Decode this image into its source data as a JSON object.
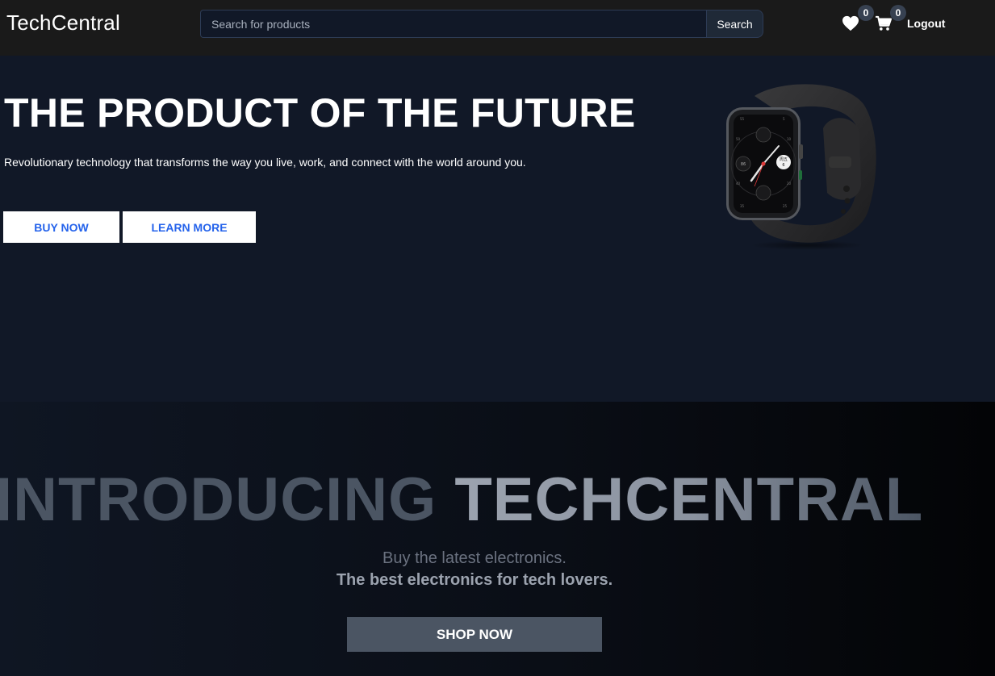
{
  "header": {
    "brand": "TechCentral",
    "search": {
      "placeholder": "Search for products",
      "value": "",
      "button_label": "Search"
    },
    "wishlist": {
      "icon": "heart-icon",
      "count": "0"
    },
    "cart": {
      "icon": "cart-icon",
      "count": "0"
    },
    "logout_label": "Logout"
  },
  "hero": {
    "title": "THE PRODUCT OF THE FUTURE",
    "subtitle": "Revolutionary technology that transforms the way you live, work, and connect with the world around you.",
    "buy_label": "BUY NOW",
    "learn_label": "LEARN MORE",
    "image": "smartwatch-image"
  },
  "intro": {
    "title_part1": "INTRODUCING",
    "title_part2": "TECHCENTRAL",
    "line1": "Buy the latest electronics.",
    "line2": "The best electronics for tech lovers.",
    "shop_label": "SHOP NOW"
  },
  "colors": {
    "header_bg": "#1a1a1a",
    "hero_bg": "#111827",
    "button_text": "#2563eb",
    "shop_button_bg": "#4b5563"
  }
}
